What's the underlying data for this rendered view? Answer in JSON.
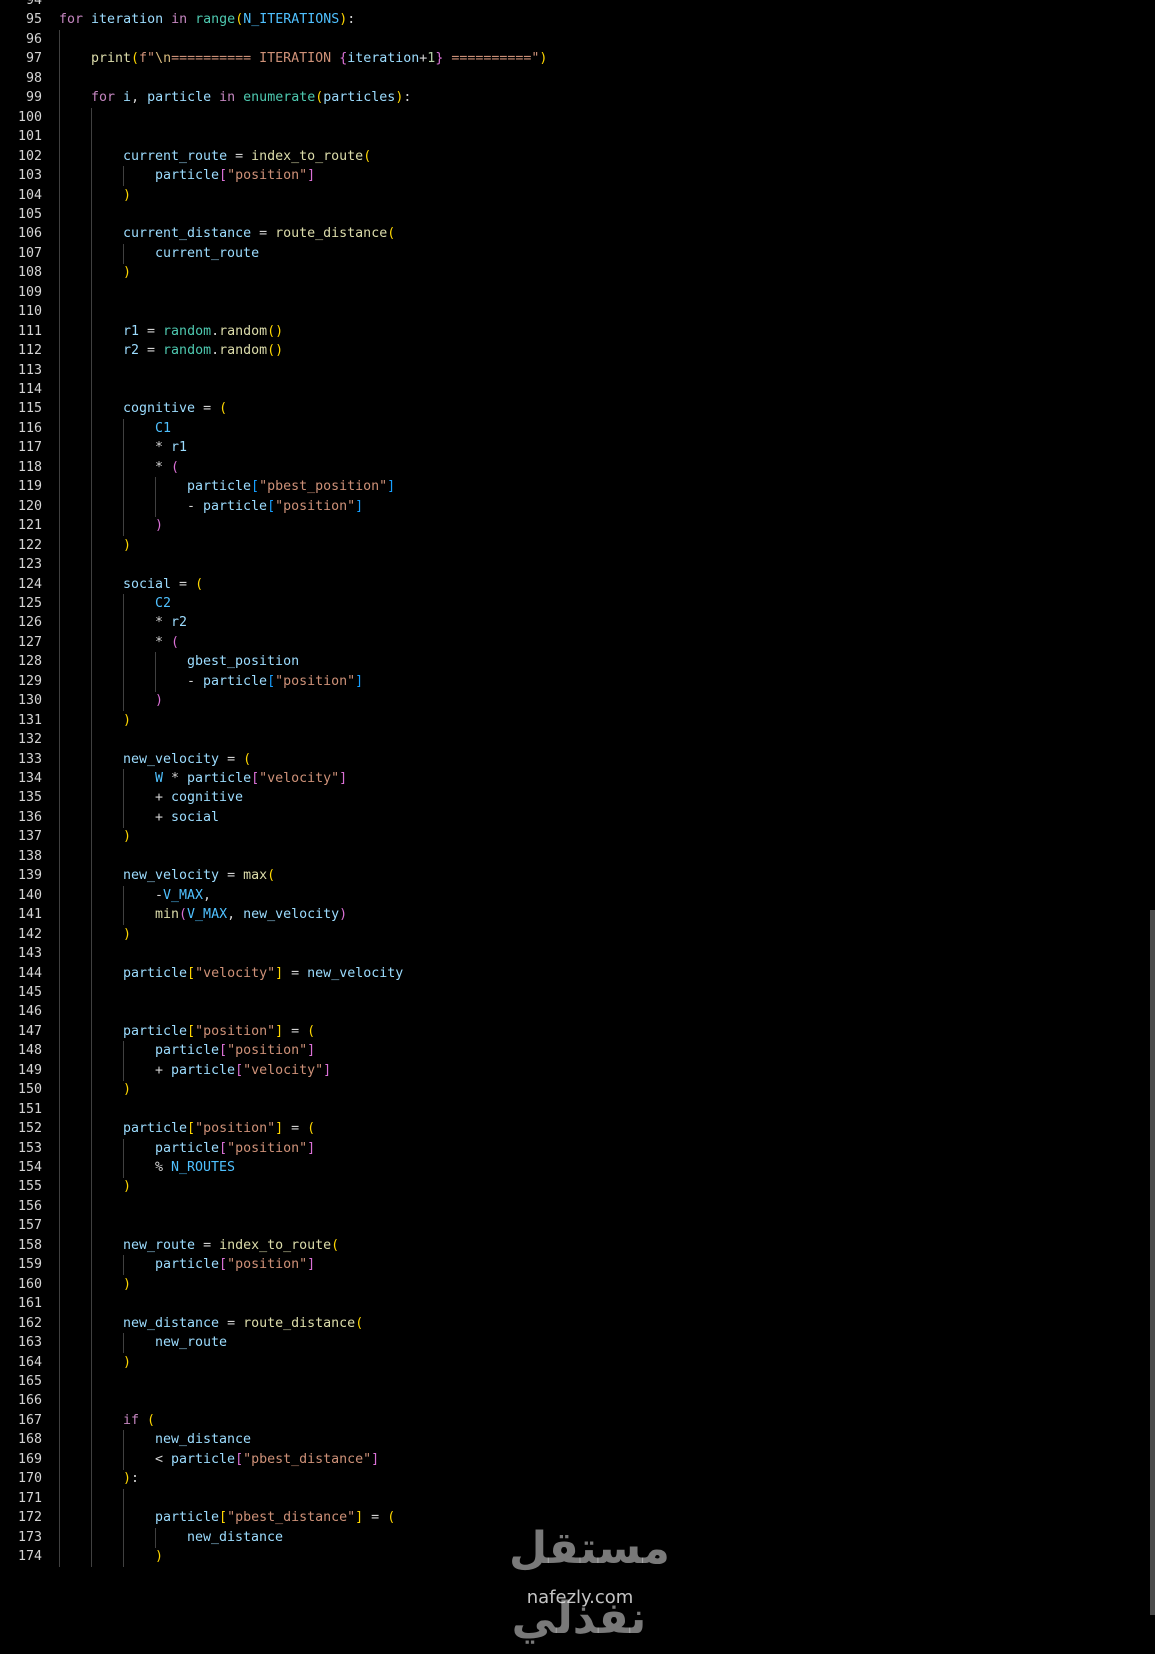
{
  "editor": {
    "language": "python",
    "lines": [
      {
        "num": "94",
        "indent": 0,
        "tokens": []
      },
      {
        "num": "95",
        "indent": 0,
        "tokens": [
          [
            "kw",
            "for"
          ],
          [
            "op",
            " "
          ],
          [
            "v",
            "iteration"
          ],
          [
            "op",
            " "
          ],
          [
            "kw",
            "in"
          ],
          [
            "op",
            " "
          ],
          [
            "bi",
            "range"
          ],
          [
            "b1",
            "("
          ],
          [
            "cn",
            "N_ITERATIONS"
          ],
          [
            "b1",
            ")"
          ],
          [
            "op",
            ":"
          ]
        ]
      },
      {
        "num": "96",
        "indent": 1,
        "tokens": []
      },
      {
        "num": "97",
        "indent": 1,
        "tokens": [
          [
            "fn",
            "print"
          ],
          [
            "b1",
            "("
          ],
          [
            "st",
            "f\""
          ],
          [
            "es",
            "\\n"
          ],
          [
            "st",
            "========== ITERATION "
          ],
          [
            "b2",
            "{"
          ],
          [
            "v",
            "iteration"
          ],
          [
            "op",
            "+"
          ],
          [
            "nm",
            "1"
          ],
          [
            "b2",
            "}"
          ],
          [
            "st",
            " ==========\""
          ],
          [
            "b1",
            ")"
          ]
        ]
      },
      {
        "num": "98",
        "indent": 1,
        "tokens": []
      },
      {
        "num": "99",
        "indent": 1,
        "tokens": [
          [
            "kw",
            "for"
          ],
          [
            "op",
            " "
          ],
          [
            "v",
            "i"
          ],
          [
            "op",
            ", "
          ],
          [
            "v",
            "particle"
          ],
          [
            "op",
            " "
          ],
          [
            "kw",
            "in"
          ],
          [
            "op",
            " "
          ],
          [
            "bi",
            "enumerate"
          ],
          [
            "b1",
            "("
          ],
          [
            "v",
            "particles"
          ],
          [
            "b1",
            ")"
          ],
          [
            "op",
            ":"
          ]
        ]
      },
      {
        "num": "100",
        "indent": 2,
        "tokens": []
      },
      {
        "num": "101",
        "indent": 2,
        "tokens": []
      },
      {
        "num": "102",
        "indent": 2,
        "tokens": [
          [
            "v",
            "current_route"
          ],
          [
            "op",
            " = "
          ],
          [
            "fn",
            "index_to_route"
          ],
          [
            "b1",
            "("
          ]
        ]
      },
      {
        "num": "103",
        "indent": 3,
        "tokens": [
          [
            "v",
            "particle"
          ],
          [
            "b2",
            "["
          ],
          [
            "st",
            "\"position\""
          ],
          [
            "b2",
            "]"
          ]
        ]
      },
      {
        "num": "104",
        "indent": 2,
        "tokens": [
          [
            "b1",
            ")"
          ]
        ]
      },
      {
        "num": "105",
        "indent": 2,
        "tokens": []
      },
      {
        "num": "106",
        "indent": 2,
        "tokens": [
          [
            "v",
            "current_distance"
          ],
          [
            "op",
            " = "
          ],
          [
            "fn",
            "route_distance"
          ],
          [
            "b1",
            "("
          ]
        ]
      },
      {
        "num": "107",
        "indent": 3,
        "tokens": [
          [
            "v",
            "current_route"
          ]
        ]
      },
      {
        "num": "108",
        "indent": 2,
        "tokens": [
          [
            "b1",
            ")"
          ]
        ]
      },
      {
        "num": "109",
        "indent": 2,
        "tokens": []
      },
      {
        "num": "110",
        "indent": 2,
        "tokens": []
      },
      {
        "num": "111",
        "indent": 2,
        "tokens": [
          [
            "v",
            "r1"
          ],
          [
            "op",
            " = "
          ],
          [
            "bi",
            "random"
          ],
          [
            "op",
            "."
          ],
          [
            "fn",
            "random"
          ],
          [
            "b1",
            "()"
          ]
        ]
      },
      {
        "num": "112",
        "indent": 2,
        "tokens": [
          [
            "v",
            "r2"
          ],
          [
            "op",
            " = "
          ],
          [
            "bi",
            "random"
          ],
          [
            "op",
            "."
          ],
          [
            "fn",
            "random"
          ],
          [
            "b1",
            "()"
          ]
        ]
      },
      {
        "num": "113",
        "indent": 2,
        "tokens": []
      },
      {
        "num": "114",
        "indent": 2,
        "tokens": []
      },
      {
        "num": "115",
        "indent": 2,
        "tokens": [
          [
            "v",
            "cognitive"
          ],
          [
            "op",
            " = "
          ],
          [
            "b1",
            "("
          ]
        ]
      },
      {
        "num": "116",
        "indent": 3,
        "tokens": [
          [
            "cn",
            "C1"
          ]
        ]
      },
      {
        "num": "117",
        "indent": 3,
        "tokens": [
          [
            "op",
            "* "
          ],
          [
            "v",
            "r1"
          ]
        ]
      },
      {
        "num": "118",
        "indent": 3,
        "tokens": [
          [
            "op",
            "* "
          ],
          [
            "b2",
            "("
          ]
        ]
      },
      {
        "num": "119",
        "indent": 4,
        "tokens": [
          [
            "v",
            "particle"
          ],
          [
            "b3",
            "["
          ],
          [
            "st",
            "\"pbest_position\""
          ],
          [
            "b3",
            "]"
          ]
        ]
      },
      {
        "num": "120",
        "indent": 4,
        "tokens": [
          [
            "op",
            "- "
          ],
          [
            "v",
            "particle"
          ],
          [
            "b3",
            "["
          ],
          [
            "st",
            "\"position\""
          ],
          [
            "b3",
            "]"
          ]
        ]
      },
      {
        "num": "121",
        "indent": 3,
        "tokens": [
          [
            "b2",
            ")"
          ]
        ]
      },
      {
        "num": "122",
        "indent": 2,
        "tokens": [
          [
            "b1",
            ")"
          ]
        ]
      },
      {
        "num": "123",
        "indent": 2,
        "tokens": []
      },
      {
        "num": "124",
        "indent": 2,
        "tokens": [
          [
            "v",
            "social"
          ],
          [
            "op",
            " = "
          ],
          [
            "b1",
            "("
          ]
        ]
      },
      {
        "num": "125",
        "indent": 3,
        "tokens": [
          [
            "cn",
            "C2"
          ]
        ]
      },
      {
        "num": "126",
        "indent": 3,
        "tokens": [
          [
            "op",
            "* "
          ],
          [
            "v",
            "r2"
          ]
        ]
      },
      {
        "num": "127",
        "indent": 3,
        "tokens": [
          [
            "op",
            "* "
          ],
          [
            "b2",
            "("
          ]
        ]
      },
      {
        "num": "128",
        "indent": 4,
        "tokens": [
          [
            "v",
            "gbest_position"
          ]
        ]
      },
      {
        "num": "129",
        "indent": 4,
        "tokens": [
          [
            "op",
            "- "
          ],
          [
            "v",
            "particle"
          ],
          [
            "b3",
            "["
          ],
          [
            "st",
            "\"position\""
          ],
          [
            "b3",
            "]"
          ]
        ]
      },
      {
        "num": "130",
        "indent": 3,
        "tokens": [
          [
            "b2",
            ")"
          ]
        ]
      },
      {
        "num": "131",
        "indent": 2,
        "tokens": [
          [
            "b1",
            ")"
          ]
        ]
      },
      {
        "num": "132",
        "indent": 2,
        "tokens": []
      },
      {
        "num": "133",
        "indent": 2,
        "tokens": [
          [
            "v",
            "new_velocity"
          ],
          [
            "op",
            " = "
          ],
          [
            "b1",
            "("
          ]
        ]
      },
      {
        "num": "134",
        "indent": 3,
        "tokens": [
          [
            "cn",
            "W"
          ],
          [
            "op",
            " * "
          ],
          [
            "v",
            "particle"
          ],
          [
            "b2",
            "["
          ],
          [
            "st",
            "\"velocity\""
          ],
          [
            "b2",
            "]"
          ]
        ]
      },
      {
        "num": "135",
        "indent": 3,
        "tokens": [
          [
            "op",
            "+ "
          ],
          [
            "v",
            "cognitive"
          ]
        ]
      },
      {
        "num": "136",
        "indent": 3,
        "tokens": [
          [
            "op",
            "+ "
          ],
          [
            "v",
            "social"
          ]
        ]
      },
      {
        "num": "137",
        "indent": 2,
        "tokens": [
          [
            "b1",
            ")"
          ]
        ]
      },
      {
        "num": "138",
        "indent": 2,
        "tokens": []
      },
      {
        "num": "139",
        "indent": 2,
        "tokens": [
          [
            "v",
            "new_velocity"
          ],
          [
            "op",
            " = "
          ],
          [
            "fn",
            "max"
          ],
          [
            "b1",
            "("
          ]
        ]
      },
      {
        "num": "140",
        "indent": 3,
        "tokens": [
          [
            "op",
            "-"
          ],
          [
            "cn",
            "V_MAX"
          ],
          [
            "op",
            ","
          ]
        ]
      },
      {
        "num": "141",
        "indent": 3,
        "tokens": [
          [
            "fn",
            "min"
          ],
          [
            "b2",
            "("
          ],
          [
            "cn",
            "V_MAX"
          ],
          [
            "op",
            ", "
          ],
          [
            "v",
            "new_velocity"
          ],
          [
            "b2",
            ")"
          ]
        ]
      },
      {
        "num": "142",
        "indent": 2,
        "tokens": [
          [
            "b1",
            ")"
          ]
        ]
      },
      {
        "num": "143",
        "indent": 2,
        "tokens": []
      },
      {
        "num": "144",
        "indent": 2,
        "tokens": [
          [
            "v",
            "particle"
          ],
          [
            "b1",
            "["
          ],
          [
            "st",
            "\"velocity\""
          ],
          [
            "b1",
            "]"
          ],
          [
            "op",
            " = "
          ],
          [
            "v",
            "new_velocity"
          ]
        ]
      },
      {
        "num": "145",
        "indent": 2,
        "tokens": []
      },
      {
        "num": "146",
        "indent": 2,
        "tokens": []
      },
      {
        "num": "147",
        "indent": 2,
        "tokens": [
          [
            "v",
            "particle"
          ],
          [
            "b1",
            "["
          ],
          [
            "st",
            "\"position\""
          ],
          [
            "b1",
            "]"
          ],
          [
            "op",
            " = "
          ],
          [
            "b1",
            "("
          ]
        ]
      },
      {
        "num": "148",
        "indent": 3,
        "tokens": [
          [
            "v",
            "particle"
          ],
          [
            "b2",
            "["
          ],
          [
            "st",
            "\"position\""
          ],
          [
            "b2",
            "]"
          ]
        ]
      },
      {
        "num": "149",
        "indent": 3,
        "tokens": [
          [
            "op",
            "+ "
          ],
          [
            "v",
            "particle"
          ],
          [
            "b2",
            "["
          ],
          [
            "st",
            "\"velocity\""
          ],
          [
            "b2",
            "]"
          ]
        ]
      },
      {
        "num": "150",
        "indent": 2,
        "tokens": [
          [
            "b1",
            ")"
          ]
        ]
      },
      {
        "num": "151",
        "indent": 2,
        "tokens": []
      },
      {
        "num": "152",
        "indent": 2,
        "tokens": [
          [
            "v",
            "particle"
          ],
          [
            "b1",
            "["
          ],
          [
            "st",
            "\"position\""
          ],
          [
            "b1",
            "]"
          ],
          [
            "op",
            " = "
          ],
          [
            "b1",
            "("
          ]
        ]
      },
      {
        "num": "153",
        "indent": 3,
        "tokens": [
          [
            "v",
            "particle"
          ],
          [
            "b2",
            "["
          ],
          [
            "st",
            "\"position\""
          ],
          [
            "b2",
            "]"
          ]
        ]
      },
      {
        "num": "154",
        "indent": 3,
        "tokens": [
          [
            "op",
            "% "
          ],
          [
            "cn",
            "N_ROUTES"
          ]
        ]
      },
      {
        "num": "155",
        "indent": 2,
        "tokens": [
          [
            "b1",
            ")"
          ]
        ]
      },
      {
        "num": "156",
        "indent": 2,
        "tokens": []
      },
      {
        "num": "157",
        "indent": 2,
        "tokens": []
      },
      {
        "num": "158",
        "indent": 2,
        "tokens": [
          [
            "v",
            "new_route"
          ],
          [
            "op",
            " = "
          ],
          [
            "fn",
            "index_to_route"
          ],
          [
            "b1",
            "("
          ]
        ]
      },
      {
        "num": "159",
        "indent": 3,
        "tokens": [
          [
            "v",
            "particle"
          ],
          [
            "b2",
            "["
          ],
          [
            "st",
            "\"position\""
          ],
          [
            "b2",
            "]"
          ]
        ]
      },
      {
        "num": "160",
        "indent": 2,
        "tokens": [
          [
            "b1",
            ")"
          ]
        ]
      },
      {
        "num": "161",
        "indent": 2,
        "tokens": []
      },
      {
        "num": "162",
        "indent": 2,
        "tokens": [
          [
            "v",
            "new_distance"
          ],
          [
            "op",
            " = "
          ],
          [
            "fn",
            "route_distance"
          ],
          [
            "b1",
            "("
          ]
        ]
      },
      {
        "num": "163",
        "indent": 3,
        "tokens": [
          [
            "v",
            "new_route"
          ]
        ]
      },
      {
        "num": "164",
        "indent": 2,
        "tokens": [
          [
            "b1",
            ")"
          ]
        ]
      },
      {
        "num": "165",
        "indent": 2,
        "tokens": []
      },
      {
        "num": "166",
        "indent": 2,
        "tokens": []
      },
      {
        "num": "167",
        "indent": 2,
        "tokens": [
          [
            "kw",
            "if"
          ],
          [
            "op",
            " "
          ],
          [
            "b1",
            "("
          ]
        ]
      },
      {
        "num": "168",
        "indent": 3,
        "tokens": [
          [
            "v",
            "new_distance"
          ]
        ]
      },
      {
        "num": "169",
        "indent": 3,
        "tokens": [
          [
            "op",
            "< "
          ],
          [
            "v",
            "particle"
          ],
          [
            "b2",
            "["
          ],
          [
            "st",
            "\"pbest_distance\""
          ],
          [
            "b2",
            "]"
          ]
        ]
      },
      {
        "num": "170",
        "indent": 2,
        "tokens": [
          [
            "b1",
            ")"
          ],
          [
            "op",
            ":"
          ]
        ]
      },
      {
        "num": "171",
        "indent": 3,
        "tokens": []
      },
      {
        "num": "172",
        "indent": 3,
        "tokens": [
          [
            "v",
            "particle"
          ],
          [
            "b1",
            "["
          ],
          [
            "st",
            "\"pbest_distance\""
          ],
          [
            "b1",
            "]"
          ],
          [
            "op",
            " = "
          ],
          [
            "b1",
            "("
          ]
        ]
      },
      {
        "num": "173",
        "indent": 4,
        "tokens": [
          [
            "v",
            "new_distance"
          ]
        ]
      },
      {
        "num": "174",
        "indent": 3,
        "tokens": [
          [
            "b1",
            ")"
          ]
        ]
      }
    ]
  },
  "watermark": {
    "logo_text": "مستقل نفذلي",
    "url": "nafezly.com"
  }
}
